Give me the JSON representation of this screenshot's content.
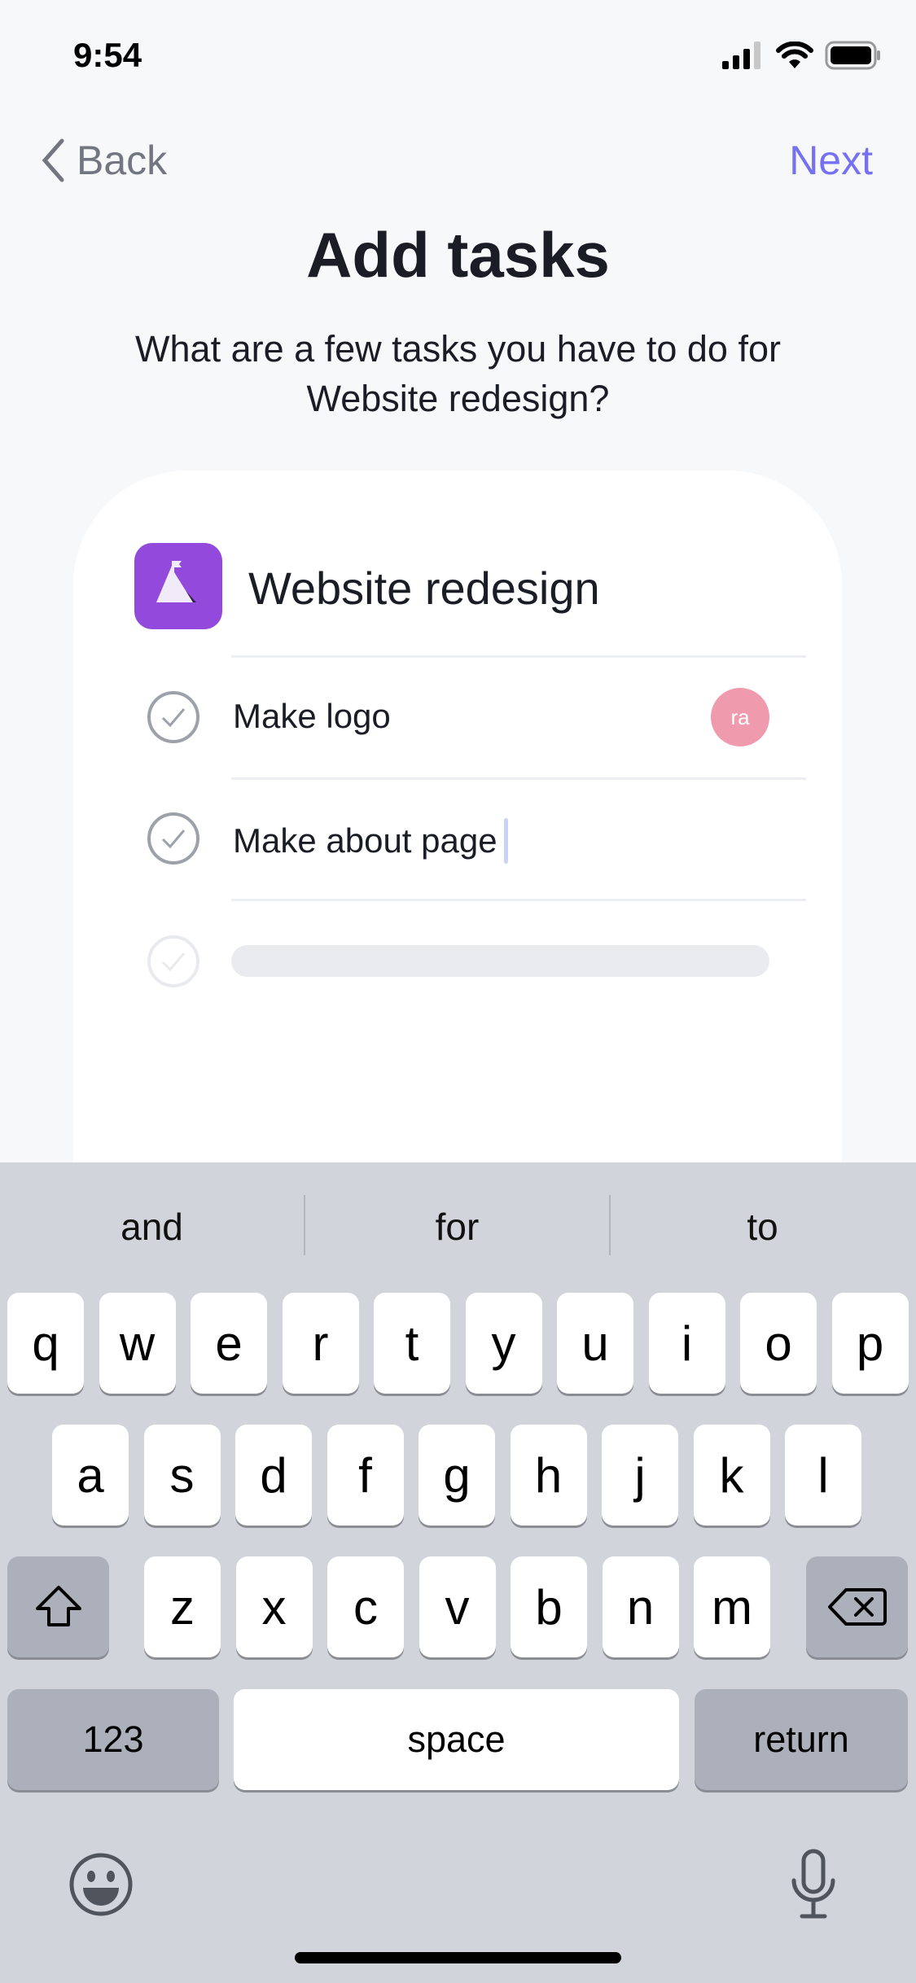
{
  "status_bar": {
    "time": "9:54",
    "icons": [
      "cellular-signal-icon",
      "wifi-icon",
      "battery-icon"
    ]
  },
  "nav": {
    "back_label": "Back",
    "next_label": "Next"
  },
  "header": {
    "title": "Add tasks",
    "subtitle_line1": "What are a few tasks you have to do for",
    "subtitle_line2": "Website redesign?"
  },
  "project": {
    "name": "Website redesign",
    "icon": "mountain-flag-icon",
    "color": "#9249dc"
  },
  "tasks": [
    {
      "name": "Make logo",
      "assignee_initials": "ra",
      "assignee_color": "#f09aae"
    },
    {
      "name": "Make about page"
    }
  ],
  "keyboard": {
    "suggestions": [
      "and",
      "for",
      "to"
    ],
    "row1": [
      "q",
      "w",
      "e",
      "r",
      "t",
      "y",
      "u",
      "i",
      "o",
      "p"
    ],
    "row2": [
      "a",
      "s",
      "d",
      "f",
      "g",
      "h",
      "j",
      "k",
      "l"
    ],
    "row3": [
      "z",
      "x",
      "c",
      "v",
      "b",
      "n",
      "m"
    ],
    "numbers_label": "123",
    "space_label": "space",
    "return_label": "return"
  },
  "colors": {
    "accent": "#7670f2",
    "keyboard_bg": "#d1d4da"
  }
}
